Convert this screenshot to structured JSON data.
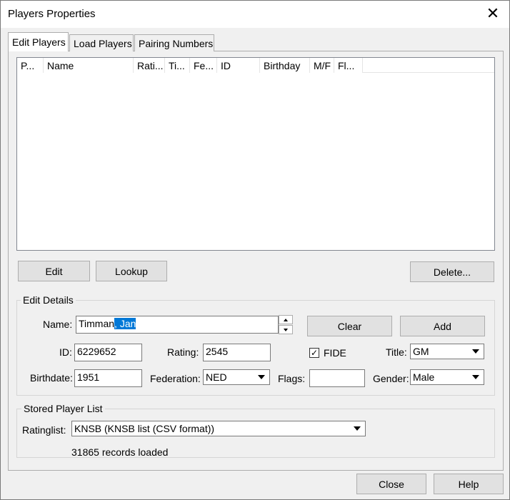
{
  "window": {
    "title": "Players Properties",
    "close_glyph": "✕"
  },
  "tabs": [
    {
      "label": "Edit Players"
    },
    {
      "label": "Load Players"
    },
    {
      "label": "Pairing Numbers"
    }
  ],
  "players_list": {
    "columns": [
      "P...",
      "Name",
      "Rati...",
      "Ti...",
      "Fe...",
      "ID",
      "Birthday",
      "M/F",
      "Fl..."
    ],
    "rows": []
  },
  "list_buttons": {
    "edit": "Edit",
    "lookup": "Lookup",
    "delete": "Delete..."
  },
  "edit_details": {
    "group_label": "Edit Details",
    "name_label": "Name:",
    "name_value_plain": "Timman",
    "name_value_selected": ", Jan",
    "clear_button": "Clear",
    "add_button": "Add",
    "id_label": "ID:",
    "id_value": "6229652",
    "rating_label": "Rating:",
    "rating_value": "2545",
    "fide_label": "FIDE",
    "fide_checked": true,
    "fide_check_glyph": "✓",
    "title_label": "Title:",
    "title_value": "GM",
    "birthdate_label": "Birthdate:",
    "birthdate_value": "1951",
    "federation_label": "Federation:",
    "federation_value": "NED",
    "flags_label": "Flags:",
    "flags_value": "",
    "gender_label": "Gender:",
    "gender_value": "Male"
  },
  "stored_list": {
    "group_label": "Stored Player List",
    "ratinglist_label": "Ratinglist:",
    "ratinglist_value": "KNSB (KNSB list (CSV format))",
    "status": "31865 records loaded"
  },
  "footer": {
    "close_button": "Close",
    "help_button": "Help"
  }
}
